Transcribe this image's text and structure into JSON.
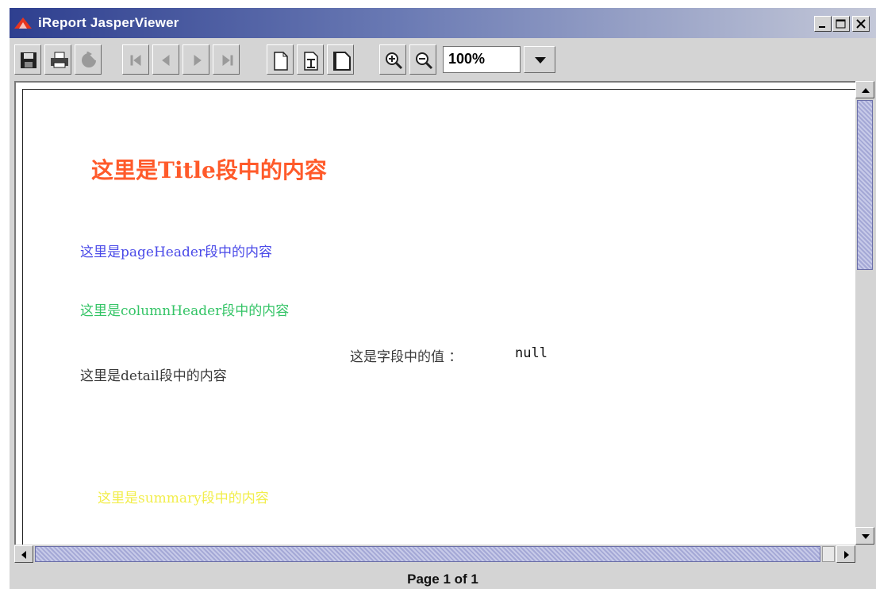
{
  "window": {
    "title": "iReport JasperViewer"
  },
  "toolbar": {
    "zoom_value": "100%"
  },
  "report": {
    "title_band": "这里是Title段中的内容",
    "page_header_band": "这里是pageHeader段中的内容",
    "column_header_band": "这里是columnHeader段中的内容",
    "field_label": "这是字段中的值 ：",
    "field_value": "null",
    "detail_band": "这里是detail段中的内容",
    "summary_band": "这里是summary段中的内容"
  },
  "status": {
    "page_text": "Page 1 of 1"
  },
  "colors": {
    "title": "#ff5a2a",
    "page_header": "#4a4ae8",
    "column_header": "#34c466",
    "detail": "#3a3a3a",
    "summary": "#f2ee4a"
  },
  "icons": [
    "app-icon",
    "save-icon",
    "print-icon",
    "reload-icon",
    "first-page-icon",
    "previous-page-icon",
    "next-page-icon",
    "last-page-icon",
    "actual-size-icon",
    "fit-page-icon",
    "fit-width-icon",
    "zoom-in-icon",
    "zoom-out-icon",
    "dropdown-arrow-icon"
  ]
}
